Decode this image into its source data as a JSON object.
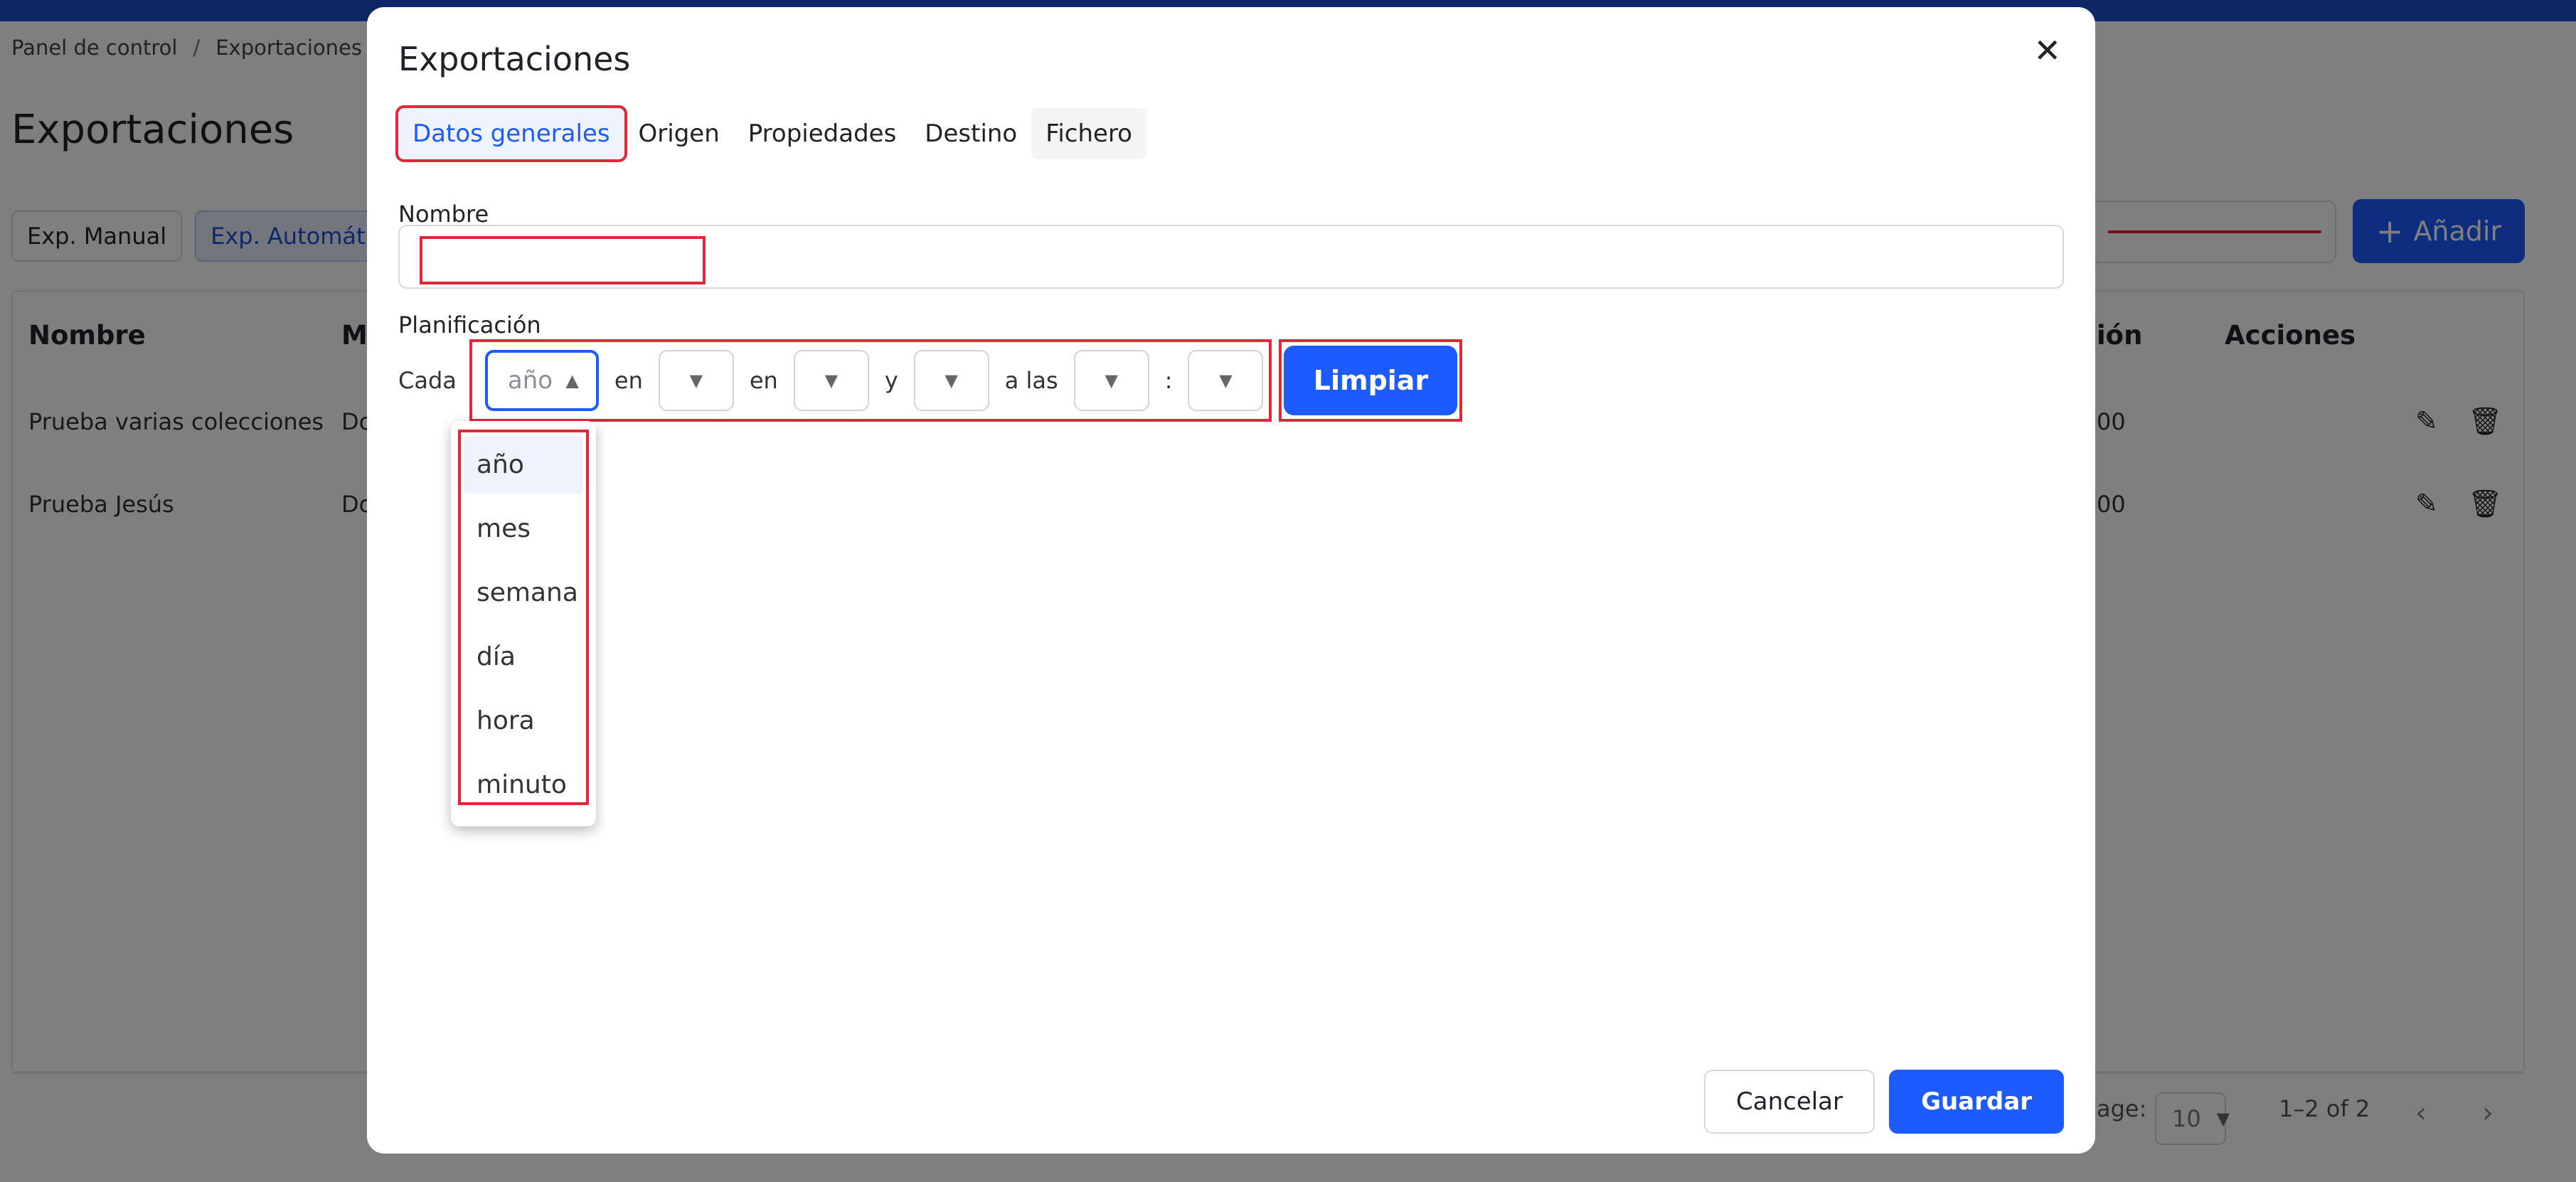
{
  "breadcrumb": {
    "items": [
      "Panel de control",
      "Exportaciones"
    ],
    "separator": "/"
  },
  "page": {
    "title": "Exportaciones",
    "type_tabs": [
      "Exp. Manual",
      "Exp. Automática"
    ],
    "add_button": "Añadir",
    "table": {
      "headers": [
        "Nombre",
        "M",
        "ión",
        "Acciones"
      ],
      "rows": [
        {
          "name": "Prueba varias colecciones",
          "col2": "Do",
          "col3": "00"
        },
        {
          "name": "Prueba Jesús",
          "col2": "Do",
          "col3": "00"
        }
      ]
    },
    "pager": {
      "per_page_label": "age:",
      "per_page_value": "10",
      "range": "1–2 of 2"
    }
  },
  "modal": {
    "title": "Exportaciones",
    "tabs": [
      "Datos generales",
      "Origen",
      "Propiedades",
      "Destino",
      "Fichero"
    ],
    "active_tab": "Datos generales",
    "name_label": "Nombre",
    "name_value": "",
    "planning_label": "Planificación",
    "planning": {
      "prefix": "Cada",
      "first_select_value": "año",
      "words": [
        "en",
        "en",
        "y",
        "a las",
        ":"
      ],
      "clear_button": "Limpiar"
    },
    "dropdown_options": [
      "año",
      "mes",
      "semana",
      "día",
      "hora",
      "minuto"
    ],
    "dropdown_selected": "año",
    "cancel_button": "Cancelar",
    "save_button": "Guardar"
  },
  "colors": {
    "accent": "#1d5bff",
    "highlight": "#e3263a",
    "topbar": "#1a4dcc"
  },
  "icons": {
    "close": "close-icon",
    "edit": "pencil-icon",
    "delete": "trash-icon",
    "caret": "caret-down-icon"
  }
}
